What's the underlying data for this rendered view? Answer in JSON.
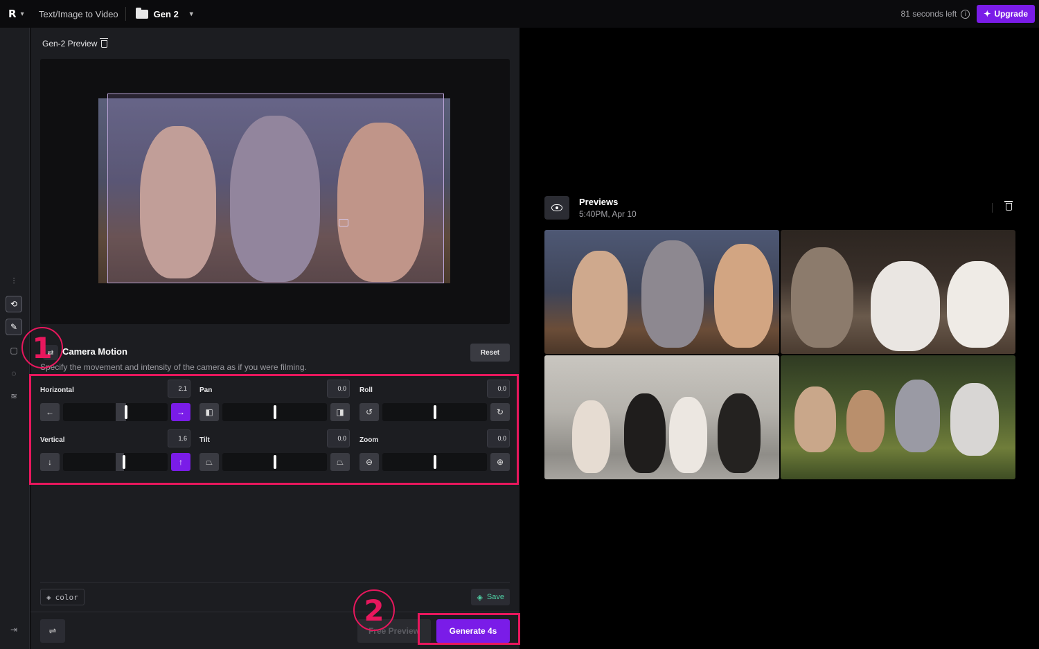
{
  "topbar": {
    "logo": "R",
    "mode": "Text/Image to Video",
    "project": "Gen 2",
    "seconds_left": "81 seconds left",
    "upgrade_label": "Upgrade"
  },
  "panel": {
    "title": "Gen-2 Preview"
  },
  "camera_motion": {
    "title": "Camera Motion",
    "description": "Specify the movement and intensity of the camera as if you were filming.",
    "reset_label": "Reset",
    "controls": [
      {
        "label": "Horizontal",
        "value": "2.1",
        "left_icon": "←",
        "right_icon": "→",
        "right_active": true,
        "level": 0.605
      },
      {
        "label": "Pan",
        "value": "0.0",
        "left_icon": "◧",
        "right_icon": "◨",
        "right_active": false,
        "level": 0.5
      },
      {
        "label": "Roll",
        "value": "0.0",
        "left_icon": "↺",
        "right_icon": "↻",
        "right_active": false,
        "level": 0.5
      },
      {
        "label": "Vertical",
        "value": "1.6",
        "left_icon": "↓",
        "right_icon": "↑",
        "right_active": true,
        "level": 0.58
      },
      {
        "label": "Tilt",
        "value": "0.0",
        "left_icon": "⏢",
        "right_icon": "⏢",
        "right_active": false,
        "level": 0.5
      },
      {
        "label": "Zoom",
        "value": "0.0",
        "left_icon": "⊖",
        "right_icon": "⊕",
        "right_active": false,
        "level": 0.5
      }
    ]
  },
  "footer": {
    "color_chip": "color",
    "save_label": "Save",
    "free_preview_label": "Free Preview",
    "generate_label": "Generate 4s"
  },
  "annotations": [
    "1",
    "2"
  ],
  "previews": {
    "title": "Previews",
    "timestamp": "5:40PM, Apr 10"
  },
  "colors": {
    "accent": "#7a1ce8",
    "annotation": "#e8175d",
    "save": "#4fd1a5"
  }
}
